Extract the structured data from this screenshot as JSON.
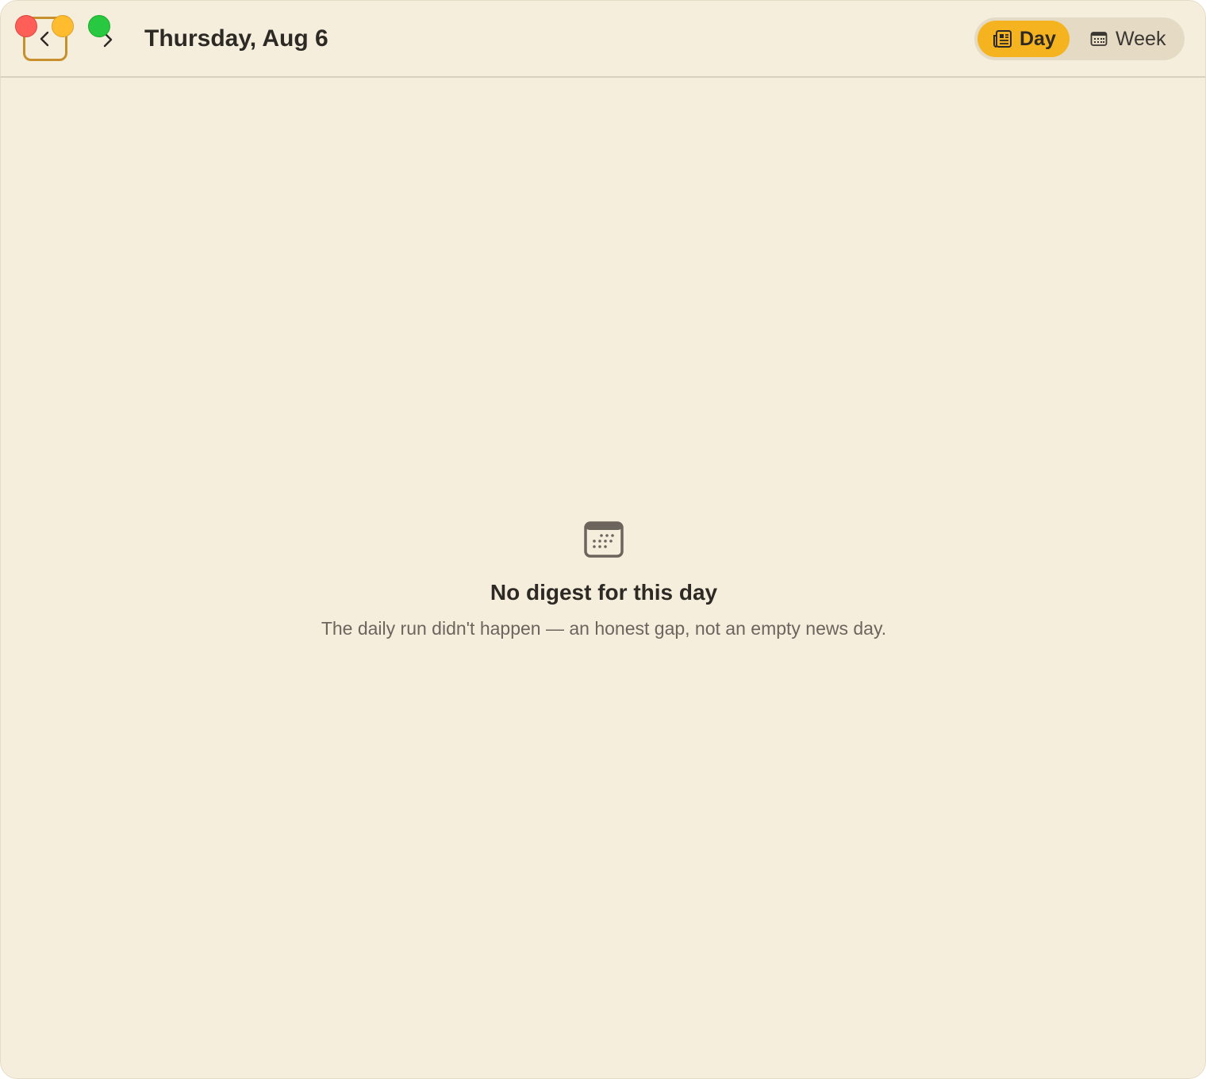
{
  "window": {
    "controls": [
      "close",
      "minimize",
      "zoom"
    ]
  },
  "toolbar": {
    "back_icon": "chevron-left-icon",
    "forward_icon": "chevron-right-icon",
    "date_title": "Thursday, Aug 6",
    "view_toggle": {
      "selected": "Day",
      "options": [
        {
          "label": "Day",
          "icon": "newspaper-icon"
        },
        {
          "label": "Week",
          "icon": "calendar-icon"
        }
      ]
    }
  },
  "empty_state": {
    "icon": "calendar-icon",
    "title": "No digest for this day",
    "message": "The daily run didn't happen — an honest gap, not an empty news day."
  },
  "colors": {
    "background": "#f6eedd",
    "accent": "#f5b31f",
    "back_button_border": "#c8902c",
    "text_primary": "#2d2a26",
    "text_secondary": "#6b655d"
  }
}
